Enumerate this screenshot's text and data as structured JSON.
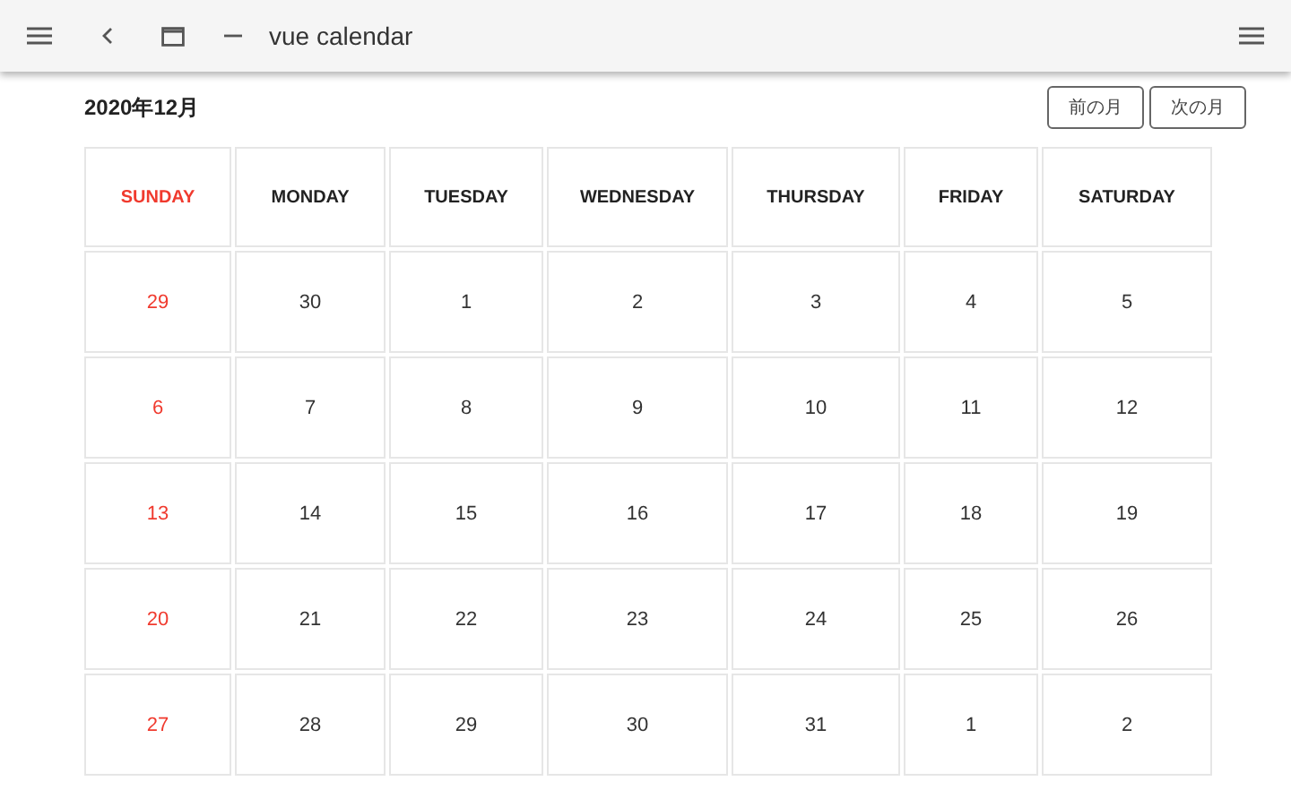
{
  "toolbar": {
    "title": "vue calendar"
  },
  "month_title": "2020年12月",
  "nav_buttons": [
    "前の月",
    "次の月"
  ],
  "weekdays": [
    {
      "label": "SUNDAY",
      "sunday": true
    },
    {
      "label": "MONDAY",
      "sunday": false
    },
    {
      "label": "TUESDAY",
      "sunday": false
    },
    {
      "label": "WEDNESDAY",
      "sunday": false
    },
    {
      "label": "THURSDAY",
      "sunday": false
    },
    {
      "label": "FRIDAY",
      "sunday": false
    },
    {
      "label": "SATURDAY",
      "sunday": false
    }
  ],
  "weeks": [
    [
      "29",
      "30",
      "1",
      "2",
      "3",
      "4",
      "5"
    ],
    [
      "6",
      "7",
      "8",
      "9",
      "10",
      "11",
      "12"
    ],
    [
      "13",
      "14",
      "15",
      "16",
      "17",
      "18",
      "19"
    ],
    [
      "20",
      "21",
      "22",
      "23",
      "24",
      "25",
      "26"
    ],
    [
      "27",
      "28",
      "29",
      "30",
      "31",
      "1",
      "2"
    ]
  ]
}
